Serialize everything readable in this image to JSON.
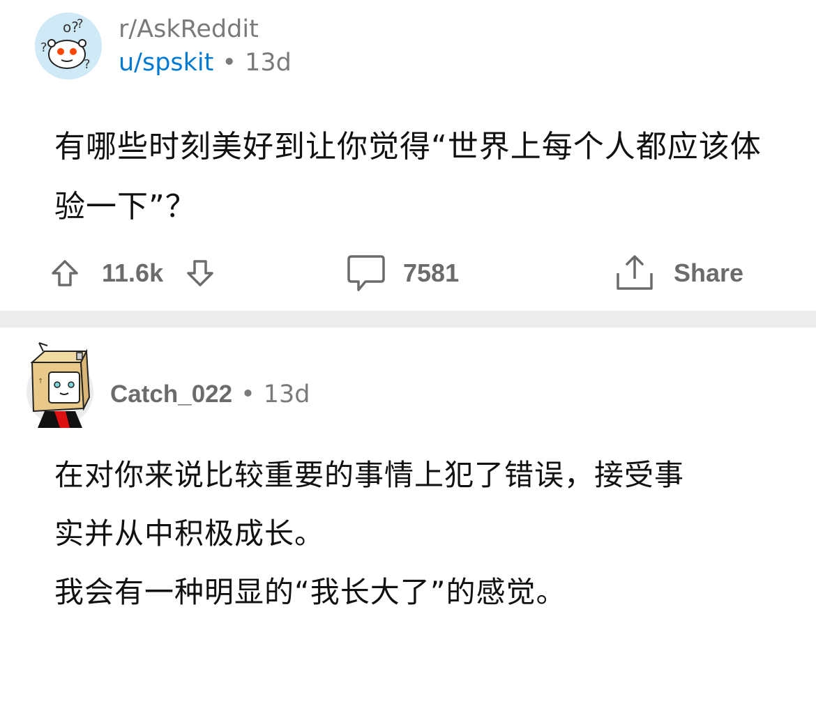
{
  "post": {
    "subreddit": "r/AskReddit",
    "author": "u/spskit",
    "separator": "•",
    "age": "13d",
    "title": "有哪些时刻美好到让你觉得“世界上每个人都应该体验一下”？",
    "upvotes": "11.6k",
    "comments": "7581",
    "share_label": "Share"
  },
  "comment": {
    "author": "Catch_022",
    "separator": "•",
    "age": "13d",
    "lines": [
      "在对你来说比较重要的事情上犯了错误，接受事",
      "实并从中积极成长。",
      "我会有一种明显的“我长大了”的感觉。"
    ]
  },
  "colors": {
    "link_blue": "#0079d3",
    "meta_gray": "#7a7a7a",
    "icon_gray": "#6b6b6b",
    "divider": "#ececec"
  },
  "icons": [
    "snoo-avatar",
    "upvote-icon",
    "downvote-icon",
    "comment-icon",
    "share-icon",
    "box-head-avatar"
  ]
}
